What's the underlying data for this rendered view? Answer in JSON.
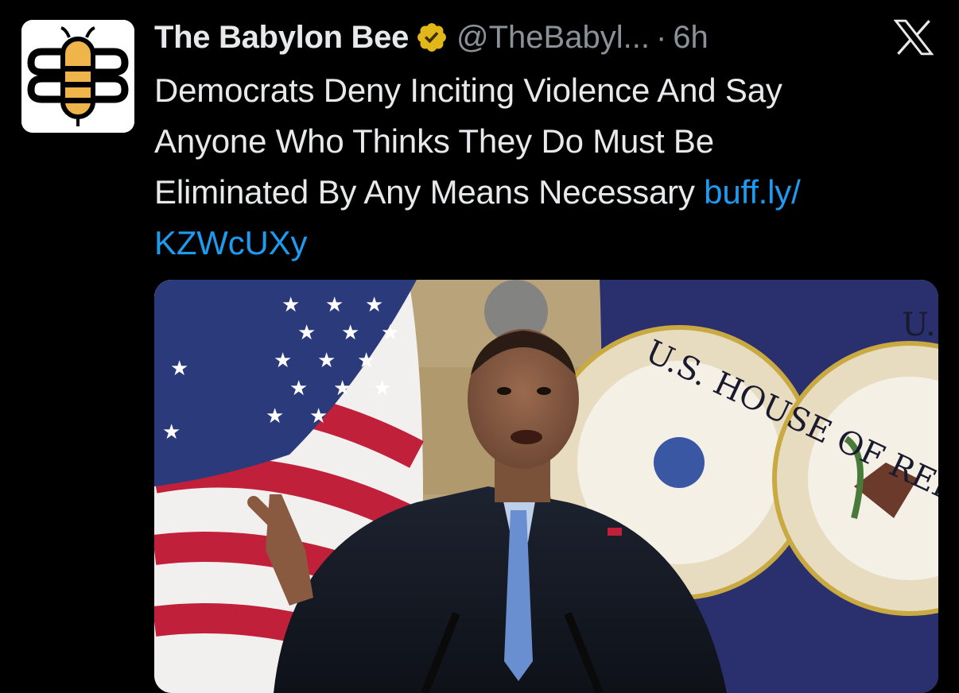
{
  "tweet": {
    "author_name": "The Babylon Bee",
    "handle": "@TheBabyl...",
    "separator": "·",
    "time": "6h",
    "text_lines": [
      "Democrats Deny Inciting Violence And Say",
      "Anyone Who Thinks They Do Must Be",
      "Eliminated By Any Means Necessary "
    ],
    "link_part1": "buff.ly/",
    "link_part2": "KZWcUXy"
  },
  "media": {
    "seal_text": "U.S. HOUSE OF REPRESENTATIVES",
    "seal_text_right": "U."
  },
  "icons": {
    "avatar": "babylon-bee-logo",
    "verified": "verified-badge-icon",
    "platform": "x-logo-icon"
  },
  "colors": {
    "background": "#000000",
    "text": "#e7e9ea",
    "secondary": "#8b9198",
    "link": "#1d9bf0",
    "verified_gold": "#e2b719"
  }
}
